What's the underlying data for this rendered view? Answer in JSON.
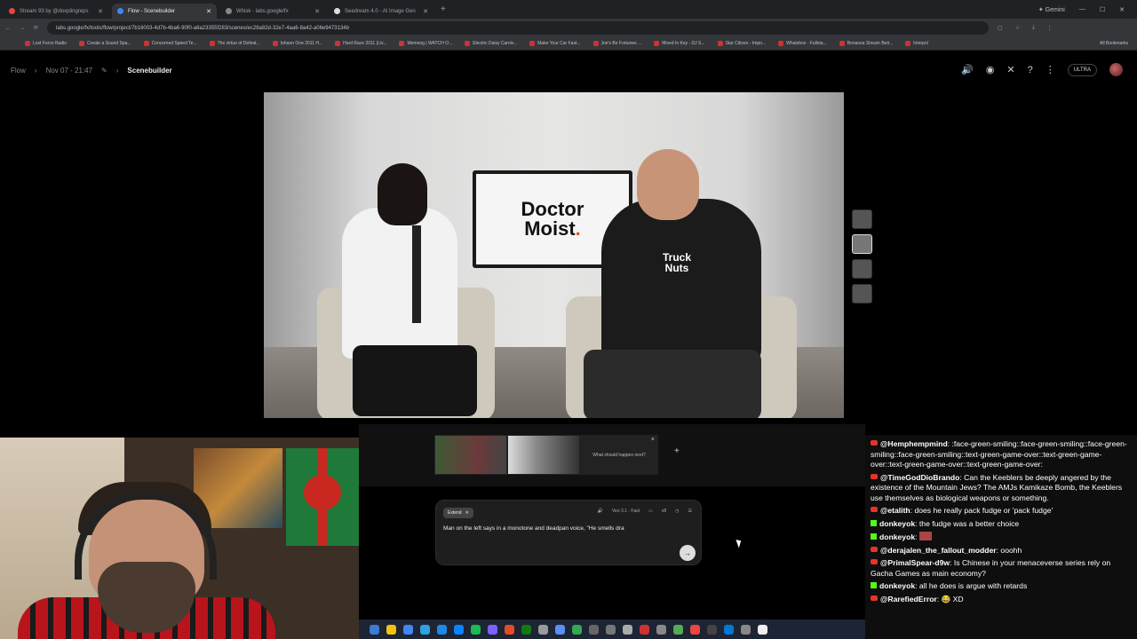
{
  "browser": {
    "tabs": [
      {
        "label": "Stream 93 by @doxplingreps",
        "active": false
      },
      {
        "label": "Flow - Scenebuilder",
        "active": true
      },
      {
        "label": "Whisk - labs.google/fx",
        "active": false
      },
      {
        "label": "Seedream 4.0 - AI Image Gen",
        "active": false
      }
    ],
    "new_tab": "+",
    "gemini_label": "Gemini",
    "url": "labs.google/fx/tools/flow/project/7b16003-4d7b-4ba6-90f0-a8a23355f283/scenes/ec28a82d-32e7-4aa6-8a42-a06e9473134b",
    "bookmarks": [
      "Lost Force Radio",
      "Create a Sound Spa...",
      "Concerned Speed Te...",
      "The virtue of Defeat...",
      "Iohann One 2011 H...",
      "Hard Race 2011 (Liv...",
      "Memeog | WATCH O...",
      "Electric Daisy Carniv...",
      "Make Your Car Fast...",
      "Joe's Be Fortunes ...",
      "Mixed In Key - DJ S...",
      "Star Citizen - Impo...",
      "Whatsbox - Fullsta...",
      "Bonanza Stream Beti...",
      "Interpol"
    ],
    "all_bookmarks": "All Bookmarks"
  },
  "app": {
    "breadcrumbs": [
      "Flow",
      "Nov 07 - 21:47",
      "Scenebuilder"
    ],
    "plan_badge": "ULTRA",
    "icons": [
      "speaker-icon",
      "discord-icon",
      "x-icon",
      "help-icon",
      "more-icon"
    ]
  },
  "video": {
    "tv_line1": "Doctor",
    "tv_line2": "Moist",
    "tv_dot": ".",
    "shirt_line1": "Truck",
    "shirt_line2": "Nuts"
  },
  "timeline": {
    "next_prompt": "What should happen next?",
    "close": "×",
    "add": "+"
  },
  "prompt": {
    "mode": "Extend",
    "model": "Veo 3.1 - Fast",
    "count": "x8",
    "text": "Man on the left says in a monotone and deadpan voice, \"He smells dra"
  },
  "chat": [
    {
      "platform": "yt",
      "user": "@Hemphempmind",
      "text": ":face-green-smiling::face-green-smiling::face-green-smiling::face-green-smiling::text-green-game-over::text-green-game-over::text-green-game-over::text-green-game-over:"
    },
    {
      "platform": "yt",
      "user": "@TimeGodDioBrando",
      "text": "Can the Keeblers be deeply angered by the existence of the Mountain Jews? The AMJs Kamikaze Bomb, the Keeblers use themselves as biological weapons or something."
    },
    {
      "platform": "yt",
      "user": "@etalith",
      "text": "does he really pack fudge or 'pack fudge'"
    },
    {
      "platform": "kick",
      "user": "donkeyok",
      "text": "the fudge was a better choice"
    },
    {
      "platform": "kick",
      "user": "donkeyok",
      "text": ""
    },
    {
      "platform": "yt",
      "user": "@derajalen_the_fallout_modder",
      "text": "ooohh"
    },
    {
      "platform": "yt",
      "user": "@PrimalSpear-d9w",
      "text": "Is Chinese in your menaceverse series rely on Gacha Games as main economy?"
    },
    {
      "platform": "kick",
      "user": "donkeyok",
      "text": "all he does is argue with retards"
    },
    {
      "platform": "yt",
      "user": "@RarefiedError",
      "text": "😂 XD"
    }
  ],
  "colors": {
    "youtube": "#e5332a",
    "kick": "#53fc18",
    "accent": "#e0522b"
  }
}
